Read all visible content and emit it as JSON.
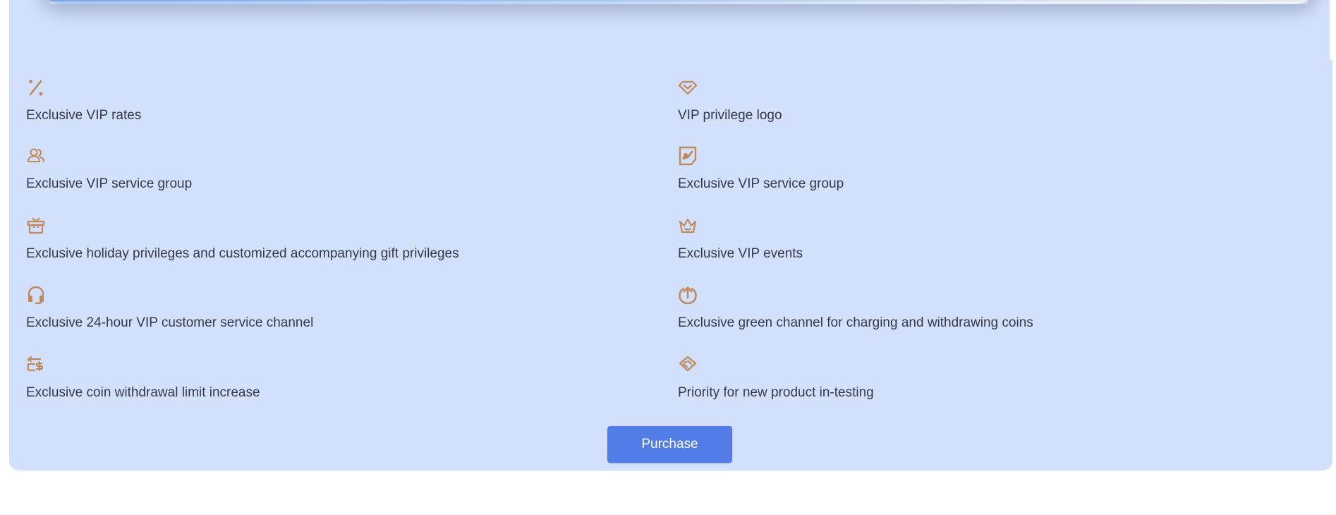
{
  "colors": {
    "panel_background": "#d3e0fc",
    "icon_color": "#bd8a5b",
    "text_color": "#333947",
    "button_background": "#537de6",
    "button_text": "#ffffff"
  },
  "features": [
    {
      "icon": "percent-icon",
      "label": "Exclusive VIP rates"
    },
    {
      "icon": "diamond-icon",
      "label": "VIP privilege logo"
    },
    {
      "icon": "users-icon",
      "label": "Exclusive VIP service group"
    },
    {
      "icon": "certificate-icon",
      "label": "Exclusive VIP service group"
    },
    {
      "icon": "gift-icon",
      "label": "Exclusive holiday privileges and customized accompanying gift privileges"
    },
    {
      "icon": "crown-icon",
      "label": "Exclusive VIP events"
    },
    {
      "icon": "headphones-icon",
      "label": "Exclusive 24-hour VIP customer service channel"
    },
    {
      "icon": "upload-circle-icon",
      "label": "Exclusive green channel for charging and withdrawing coins"
    },
    {
      "icon": "coin-withdraw-icon",
      "label": "Exclusive coin withdrawal limit increase"
    },
    {
      "icon": "handshake-icon",
      "label": "Priority for new product in-testing"
    }
  ],
  "purchase": {
    "label": "Purchase"
  }
}
